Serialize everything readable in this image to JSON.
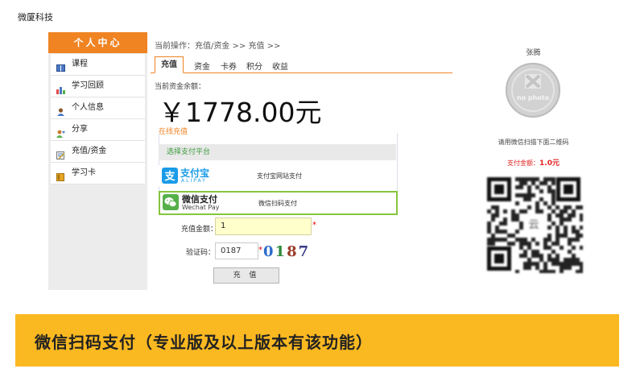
{
  "company": "微厦科技",
  "sidebar": {
    "header": "个人中心",
    "items": [
      {
        "label": "课程",
        "icon": "book-icon"
      },
      {
        "label": "学习回顾",
        "icon": "chart-icon"
      },
      {
        "label": "个人信息",
        "icon": "user-icon"
      },
      {
        "label": "分享",
        "icon": "share-icon"
      },
      {
        "label": "充值/资金",
        "icon": "recharge-icon"
      },
      {
        "label": "学习卡",
        "icon": "card-icon"
      }
    ]
  },
  "main": {
    "breadcrumb": "当前操作：充值/资金 >> 充值 >>",
    "tabs": [
      "充值",
      "资金",
      "卡券",
      "积分",
      "收益"
    ],
    "balance_label": "当前资金余额：",
    "balance": "￥1778.00元",
    "online_title": "在线充值",
    "platform_label": "选择支付平台",
    "payments": [
      {
        "name": "支付宝",
        "sub": "ALIPAY",
        "desc": "支付宝网站支付"
      },
      {
        "name": "微信支付",
        "sub": "Wechat Pay",
        "desc": "微信扫码支付"
      }
    ],
    "amount_label": "充值金额：",
    "amount_value": "1",
    "code_label": "验证码：",
    "code_value": "0187",
    "required_mark": "*",
    "captcha": [
      "0",
      "1",
      "8",
      "7"
    ],
    "submit": "充 值"
  },
  "right": {
    "username": "张腾",
    "avatar_text": "no photo",
    "scan_hint": "请用微信扫描下面二维码",
    "pay_label": "支付金额：",
    "pay_value": "1.0元"
  },
  "banner": "微信扫码支付（专业版及以上版本有该功能）",
  "colors": {
    "accent": "#f08322",
    "banner": "#fbb921",
    "wechat_green": "#86c53d",
    "alipay_blue": "#1a9be8",
    "pay_red": "#e02222"
  }
}
